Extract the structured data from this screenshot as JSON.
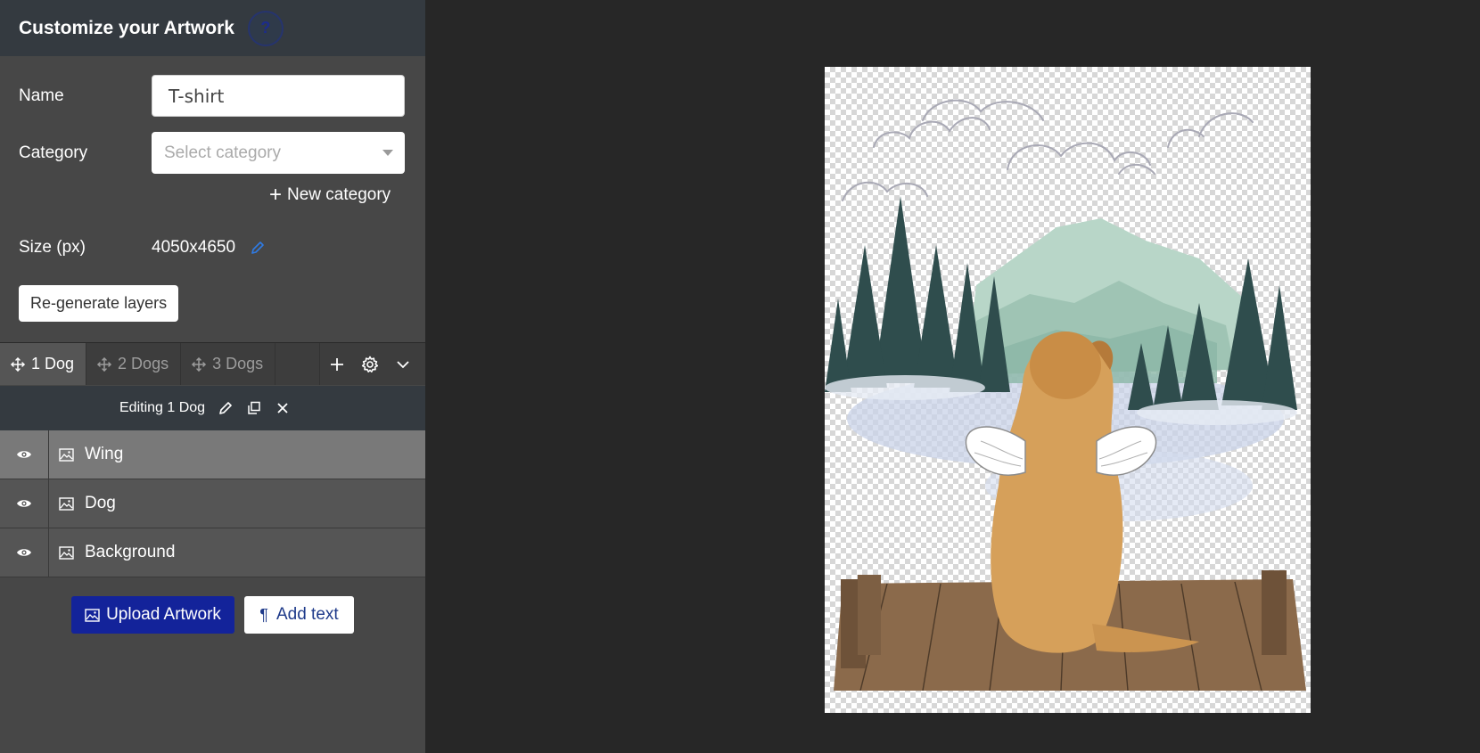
{
  "header": {
    "title": "Customize your Artwork",
    "help_icon": "question-icon"
  },
  "form": {
    "name_label": "Name",
    "name_value": "T-shirt",
    "category_label": "Category",
    "category_placeholder": "Select category",
    "new_category_label": "New category",
    "size_label": "Size (px)",
    "size_value": "4050x4650",
    "regenerate_label": "Re-generate layers"
  },
  "tabs": [
    {
      "label": "1 Dog",
      "active": true
    },
    {
      "label": "2 Dogs",
      "active": false
    },
    {
      "label": "3 Dogs",
      "active": false
    }
  ],
  "edit_bar": {
    "label": "Editing 1 Dog"
  },
  "layers": [
    {
      "label": "Wing",
      "selected": true
    },
    {
      "label": "Dog",
      "selected": false
    },
    {
      "label": "Background",
      "selected": false
    }
  ],
  "actions": {
    "upload_label": "Upload Artwork",
    "add_text_label": "Add text"
  },
  "colors": {
    "accent_blue": "#13239a",
    "sidebar_bg": "#474747",
    "header_bg": "#343a40",
    "workspace_bg": "#272727"
  }
}
